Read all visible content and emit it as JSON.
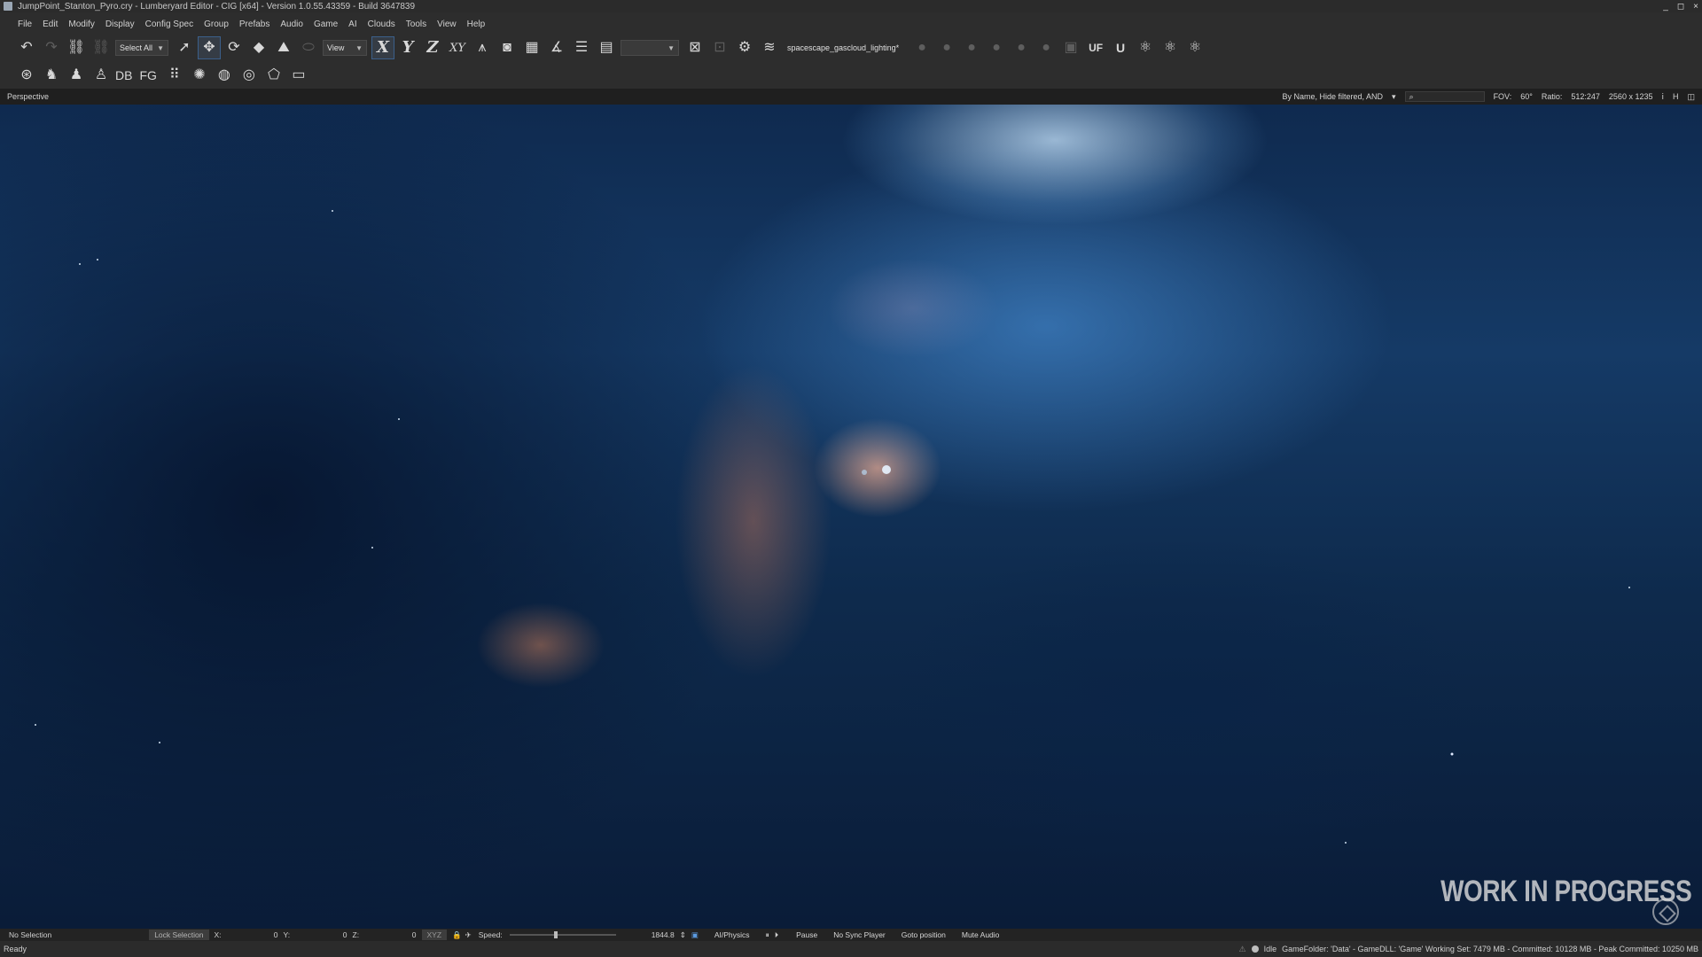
{
  "window": {
    "title": "JumpPoint_Stanton_Pyro.cry - Lumberyard Editor - CIG [x64] - Version 1.0.55.43359 - Build 3647839",
    "controls": [
      "_",
      "◻",
      "×"
    ]
  },
  "menu": [
    "File",
    "Edit",
    "Modify",
    "Display",
    "Config Spec",
    "Group",
    "Prefabs",
    "Audio",
    "Game",
    "AI",
    "Clouds",
    "Tools",
    "View",
    "Help"
  ],
  "toolbar": {
    "select_all": "Select All",
    "view_select": "View",
    "axis_x": "X",
    "axis_y": "Y",
    "axis_z": "Z",
    "axis_xy": "XY",
    "layer_name": "spacescape_gascloud_lighting*",
    "uf_label": "UF",
    "u_label": "U"
  },
  "toolbar2": {
    "db_label": "DB",
    "fg_label": "FG"
  },
  "viewport": {
    "mode": "Perspective",
    "filter_text": "By Name, Hide filtered, AND",
    "fov_label": "FOV:",
    "fov_value": "60°",
    "ratio_label": "Ratio:",
    "ratio_value": "512:247",
    "resolution": "2560 x 1235",
    "watermark": "WORK IN PROGRESS"
  },
  "status": {
    "selection": "No Selection",
    "lock_selection": "Lock Selection",
    "x_label": "X:",
    "x_value": "0",
    "y_label": "Y:",
    "y_value": "0",
    "z_label": "Z:",
    "z_value": "0",
    "xyz_label": "XYZ",
    "speed_label": "Speed:",
    "speed_value": "1844.8",
    "speed_slider_fraction": 0.42,
    "ai_physics": "AI/Physics",
    "pause": "Pause",
    "no_sync_player": "No Sync Player",
    "goto_position": "Goto position",
    "mute_audio": "Mute Audio",
    "ready": "Ready",
    "idle": "Idle",
    "game_info": "GameFolder: 'Data' - GameDLL: 'Game'   Working Set: 7479 MB - Committed: 10128 MB - Peak Committed: 10250 MB"
  }
}
